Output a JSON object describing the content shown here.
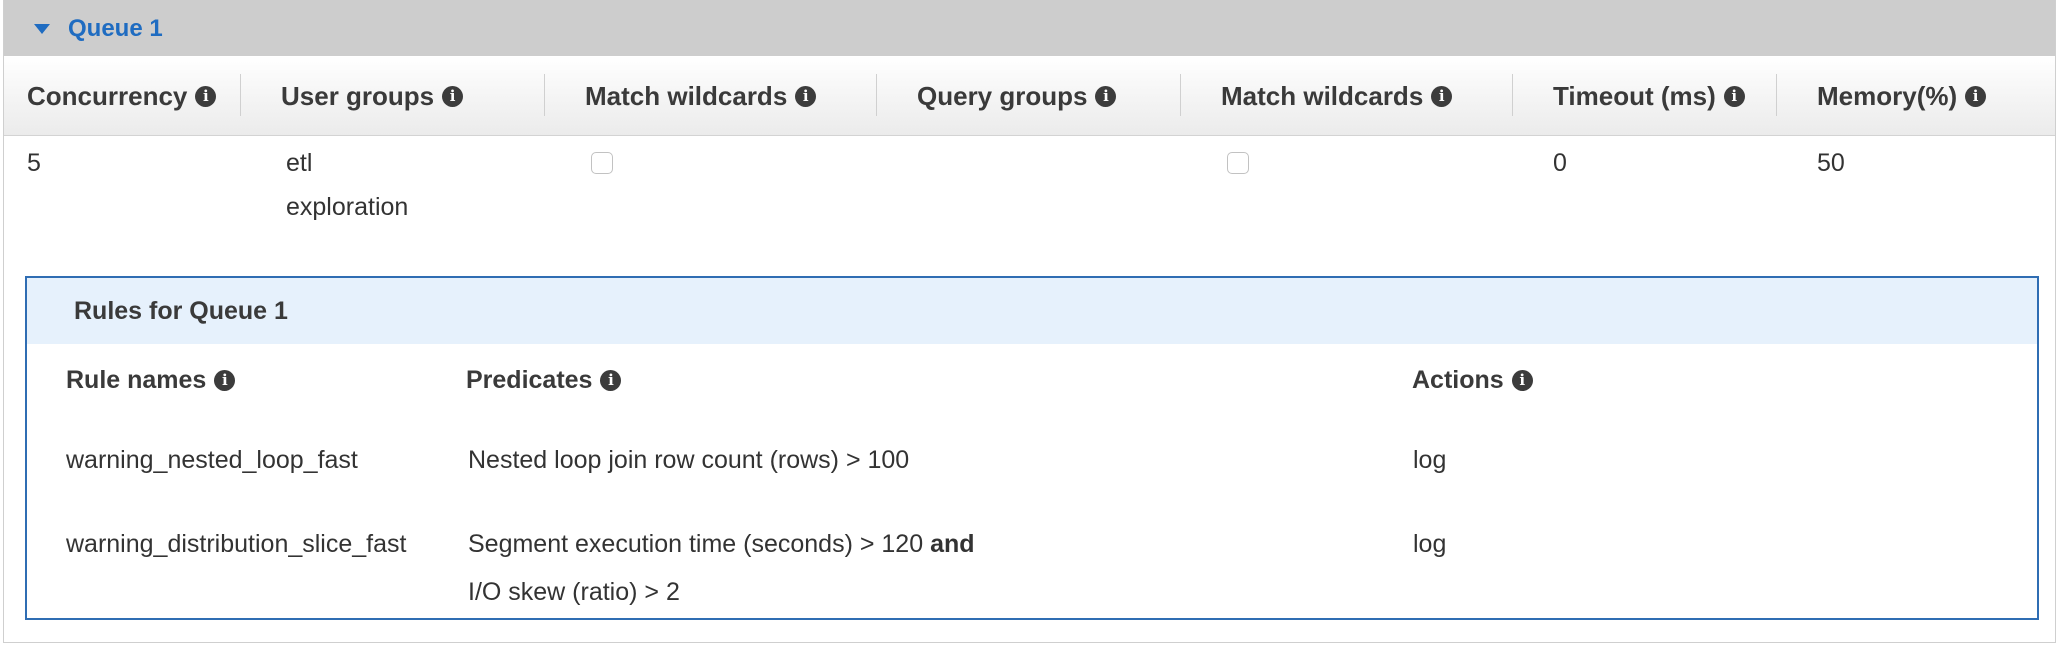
{
  "queue": {
    "title": "Queue 1",
    "columns": [
      "Concurrency",
      "User groups",
      "Match wildcards",
      "Query groups",
      "Match wildcards",
      "Timeout (ms)",
      "Memory(%)"
    ],
    "row": {
      "concurrency": "5",
      "user_groups": [
        "etl",
        "exploration"
      ],
      "user_groups_wildcard_checked": false,
      "query_groups": "",
      "query_groups_wildcard_checked": false,
      "timeout_ms": "0",
      "memory_pct": "50"
    }
  },
  "rules": {
    "title": "Rules for Queue 1",
    "columns": [
      "Rule names",
      "Predicates",
      "Actions"
    ],
    "items": [
      {
        "name": "warning_nested_loop_fast",
        "predicate_lines": [
          "Nested loop join row count (rows) > 100"
        ],
        "action": "log"
      },
      {
        "name": "warning_distribution_slice_fast",
        "predicate_line1": "Segment execution time (seconds) > 120",
        "predicate_connector": "and",
        "predicate_line2": "I/O skew (ratio) > 2",
        "action": "log"
      }
    ]
  },
  "icons": {
    "info": "info-icon",
    "caret": "caret-down-icon"
  },
  "colors": {
    "accent": "#1f6cc1",
    "rules_border": "#2f6db3",
    "rules_header_bg": "#e6f1fc",
    "queue_header_bg": "#cdcdcd"
  }
}
